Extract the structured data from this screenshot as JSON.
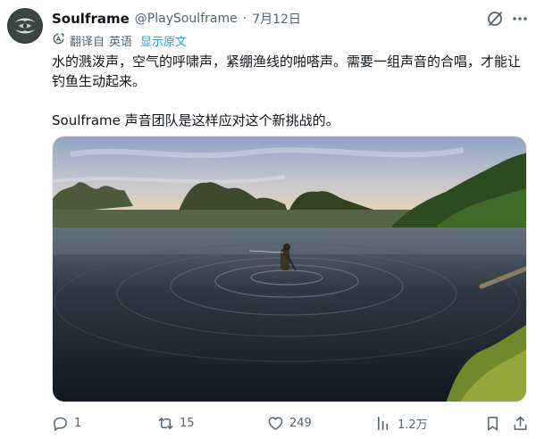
{
  "post": {
    "author": {
      "display_name": "Soulframe",
      "handle": "@PlaySoulframe",
      "separator": "·",
      "date": "7月12日"
    },
    "translation": {
      "label": "翻译自",
      "language": "英语",
      "show_original": "显示原文"
    },
    "text": {
      "paragraph_1": "水的溅泼声，空气的呼啸声，紧绷渔线的啪嗒声。需要一组声音的合唱，才能让钓鱼生动起来。",
      "paragraph_2": "Soulframe 声音团队是这样应对这个新挑战的。"
    },
    "media": {
      "type": "video-thumbnail",
      "scene": "fishing-in-river-at-sunset"
    },
    "actions": {
      "replies": "1",
      "reposts": "15",
      "likes": "249",
      "views": "1.2万"
    }
  },
  "icons": {
    "grok": "grok-icon",
    "more": "more-icon",
    "translate": "translate-icon",
    "reply": "reply-icon",
    "repost": "repost-icon",
    "like": "like-icon",
    "views": "views-icon",
    "bookmark": "bookmark-icon",
    "share": "share-icon"
  },
  "colors": {
    "text": "#0f1419",
    "muted": "#536471",
    "link": "#1d9bf0"
  }
}
